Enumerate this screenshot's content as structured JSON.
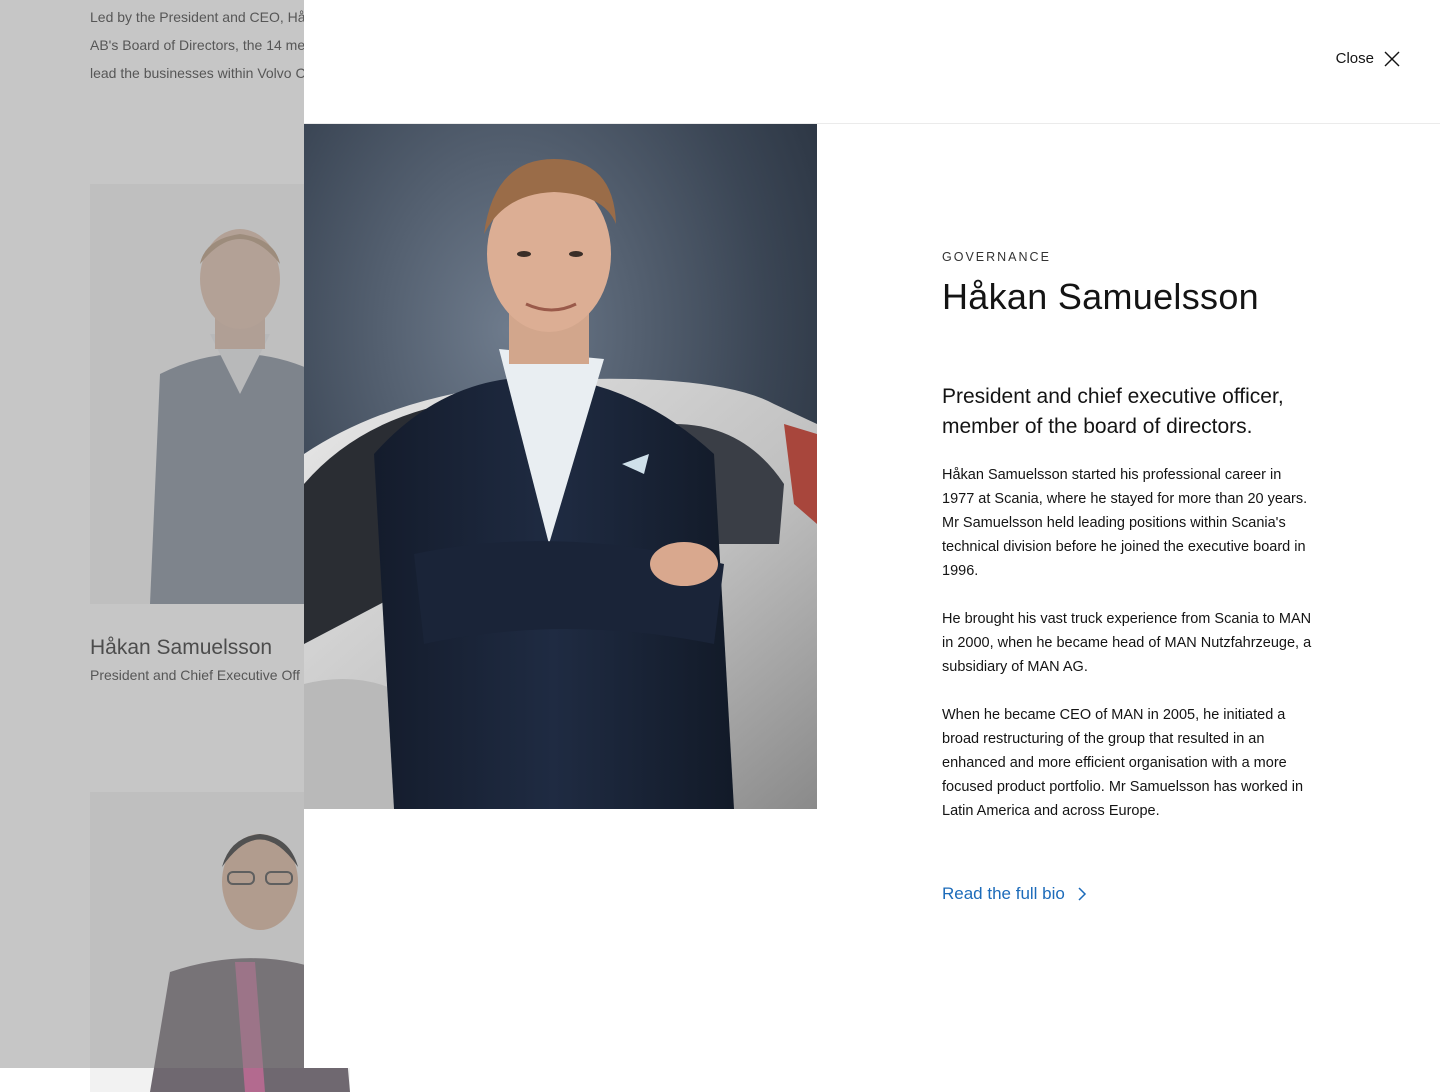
{
  "background": {
    "intro_lines": [
      "Led by the President and CEO, Hå",
      "AB's Board of Directors, the 14 me",
      "lead the businesses within Volvo C"
    ],
    "person_name": "Håkan Samuelsson",
    "person_role": "President and Chief Executive Off"
  },
  "modal": {
    "close_label": "Close",
    "eyebrow": "GOVERNANCE",
    "name": "Håkan Samuelsson",
    "title": "President and chief executive officer, member of the board of directors.",
    "paragraphs": [
      "Håkan Samuelsson started his professional career in 1977 at Scania, where he stayed for more than 20 years. Mr Samuelsson held leading positions within Scania's technical division before he joined the executive board in 1996.",
      "He brought his vast truck experience from Scania to MAN in 2000, when he became head of MAN Nutzfahrzeuge, a subsidiary of MAN AG.",
      "When he became CEO of MAN in 2005, he initiated a broad restructuring of the group that resulted in an enhanced and more efficient organisation with a more focused product portfolio.  Mr Samuelsson has worked in Latin America and across Europe."
    ],
    "read_more_label": "Read the full bio"
  },
  "colors": {
    "link": "#1c6bba",
    "overlay": "rgba(128,128,128,0.45)"
  },
  "icons": {
    "close": "close-icon",
    "read_more": "chevron-right-icon"
  }
}
